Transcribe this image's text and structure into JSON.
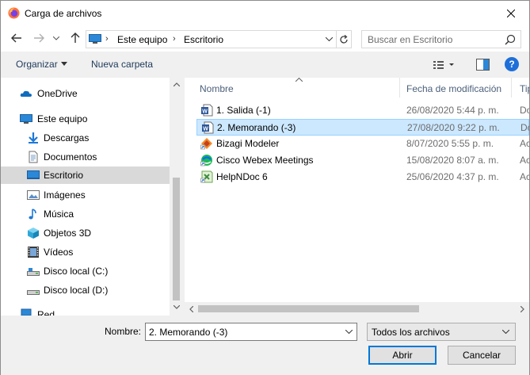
{
  "window": {
    "title": "Carga de archivos"
  },
  "address": {
    "crumbs": [
      "Este equipo",
      "Escritorio"
    ]
  },
  "search": {
    "placeholder": "Buscar en Escritorio"
  },
  "toolbar": {
    "organize_label": "Organizar",
    "new_folder_label": "Nueva carpeta",
    "help_label": "?"
  },
  "sidebar": {
    "items": [
      {
        "label": "OneDrive",
        "icon": "cloud-icon"
      },
      {
        "label": "Este equipo",
        "icon": "computer-icon"
      },
      {
        "label": "Descargas",
        "icon": "download-icon"
      },
      {
        "label": "Documentos",
        "icon": "document-icon"
      },
      {
        "label": "Escritorio",
        "icon": "desktop-icon",
        "selected": true
      },
      {
        "label": "Imágenes",
        "icon": "image-icon"
      },
      {
        "label": "Música",
        "icon": "music-icon"
      },
      {
        "label": "Objetos 3D",
        "icon": "cube-icon"
      },
      {
        "label": "Vídeos",
        "icon": "video-icon"
      },
      {
        "label": "Disco local (C:)",
        "icon": "drive-icon"
      },
      {
        "label": "Disco local (D:)",
        "icon": "drive-icon"
      },
      {
        "label": "Red",
        "icon": "network-icon"
      }
    ]
  },
  "filelist": {
    "columns": {
      "name": "Nombre",
      "date": "Fecha de modificación",
      "type": "Tip"
    },
    "rows": [
      {
        "name": "1. Salida (-1)",
        "date": "26/08/2020 5:44 p. m.",
        "type": "Do",
        "icon": "word-doc-icon"
      },
      {
        "name": "2. Memorando (-3)",
        "date": "27/08/2020 9:22 p. m.",
        "type": "Do",
        "icon": "word-doc-icon",
        "selected": true
      },
      {
        "name": "Bizagi Modeler",
        "date": "8/07/2020 5:55 p. m.",
        "type": "Ac",
        "icon": "bizagi-shortcut-icon"
      },
      {
        "name": "Cisco Webex Meetings",
        "date": "15/08/2020 8:07 a. m.",
        "type": "Ac",
        "icon": "webex-shortcut-icon"
      },
      {
        "name": "HelpNDoc 6",
        "date": "25/06/2020 4:37 p. m.",
        "type": "Ac",
        "icon": "helpndoc-shortcut-icon"
      }
    ]
  },
  "bottom": {
    "name_label": "Nombre:",
    "name_value": "2. Memorando (-3)",
    "filetype_value": "Todos los archivos",
    "open_label": "Abrir",
    "cancel_label": "Cancelar"
  },
  "colors": {
    "accent": "#0078d7",
    "selection": "#cce8ff",
    "help_blue": "#1e6fd9"
  }
}
